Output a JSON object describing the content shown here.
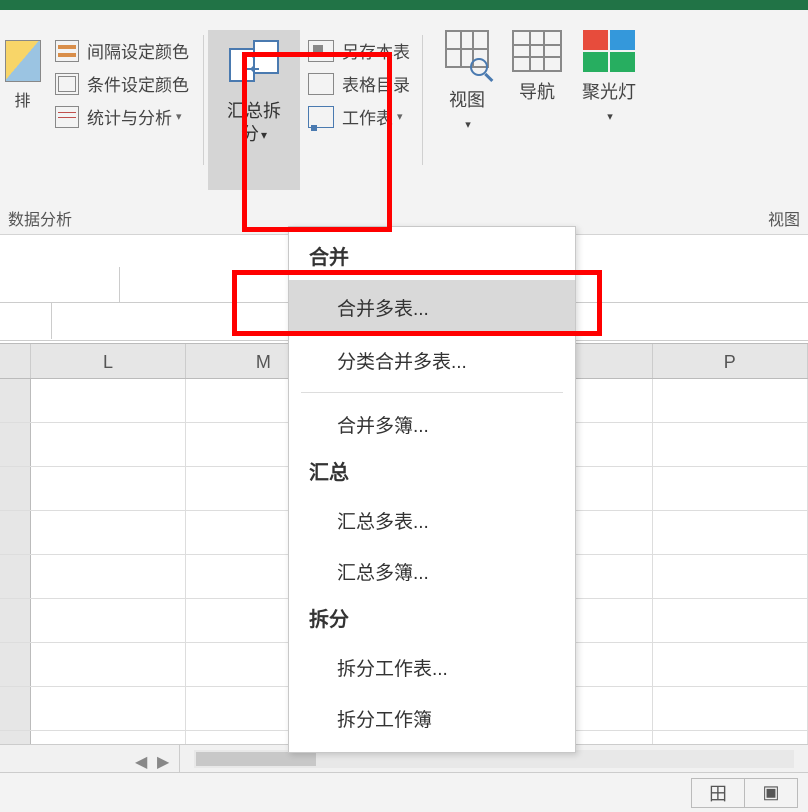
{
  "ribbon": {
    "sort_label": "排",
    "analysis": {
      "interval_color": "间隔设定颜色",
      "conditional_color": "条件设定颜色",
      "stats_analysis": "统计与分析"
    },
    "split_merge_label": "汇总拆分",
    "workbook": {
      "save_as": "另存本表",
      "toc": "表格目录",
      "worksheet": "工作表"
    },
    "view_label": "视图",
    "nav_label": "导航",
    "spotlight_label": "聚光灯",
    "footer_left": "数据分析",
    "footer_right": "视图"
  },
  "dropdown": {
    "section_merge": "合并",
    "merge_tables": "合并多表...",
    "categorize_merge": "分类合并多表...",
    "merge_workbooks": "合并多簿...",
    "section_summary": "汇总",
    "summary_tables": "汇总多表...",
    "summary_workbooks": "汇总多簿...",
    "section_split": "拆分",
    "split_worksheet": "拆分工作表...",
    "split_workbook_partial": "拆分工作簿"
  },
  "columns": [
    "L",
    "M",
    "P"
  ],
  "chevron": "▾",
  "chevron_small": "▾",
  "scroll_left": "◀",
  "scroll_right": "▶",
  "view_normal": "田",
  "view_page": "▣"
}
